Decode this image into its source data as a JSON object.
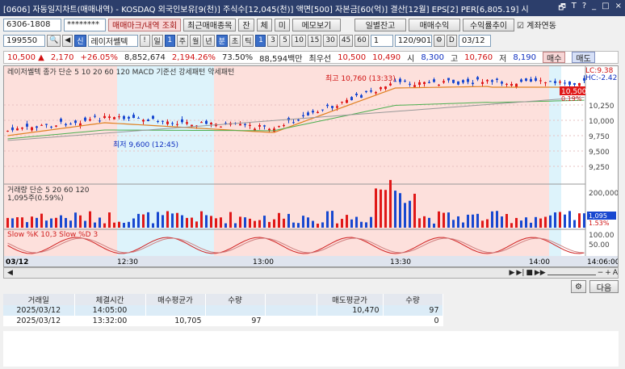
{
  "titlebar": {
    "text": "[0606] 자동일지차트(매매내역) - KOSDAQ 외국인보유[9(천)] 주식수[12,045(천)] 액면[500] 자본금[60(억)] 결산[12월] EPS[2] PER[6,805.19] 시",
    "controls": [
      "🗗",
      "T",
      "?",
      "_",
      "□",
      "×"
    ]
  },
  "toolbar1": {
    "account": "6306-1808",
    "password": "********",
    "buttons": [
      "매매마크/내역 조회",
      "최근매매종목",
      "잔",
      "체",
      "미",
      "메모보기",
      "일별잔고",
      "매매수익",
      "수익률추이"
    ],
    "checkbox": "계좌연동"
  },
  "toolbar2": {
    "code": "199550",
    "stock_label": "레이저쎌텍",
    "period": "일",
    "period_value": "1",
    "units": [
      "주",
      "월",
      "년",
      "분",
      "초",
      "틱"
    ],
    "active_unit": "분",
    "intervals": [
      "1",
      "3",
      "5",
      "10",
      "15",
      "30",
      "45",
      "60"
    ],
    "count": "1",
    "page": "120/901",
    "date": "03/12",
    "date_check": "D"
  },
  "quote": {
    "price": "10,500 ▲",
    "change": "2,170",
    "pct": "+26.05%",
    "volume": "8,852,674",
    "vol_pct": "2,194.26%",
    "ratio": "73.50%",
    "amount": "88,594백만",
    "best_sell_label": "최우선",
    "best_sell": "10,500",
    "best_buy": "10,490",
    "open_label": "시",
    "open": "8,300",
    "high_label": "고",
    "high": "10,760",
    "low_label": "저",
    "low": "8,190",
    "buy_btn": "매수",
    "sell_btn": "매도"
  },
  "chart": {
    "legend_main": "레이저쎌텍  종가 단순 5 10 20 60 120  MACD 기준선 강세패턴 약세패턴",
    "lc": "LC:9.38",
    "hc": "HC:-2.42",
    "last": "10,500",
    "last_pct": "0.19%",
    "high_note": "최고 10,760 (13:33)",
    "low_note": "최저 9,600 (12:45)",
    "y_ticks": [
      "10,250",
      "10,000",
      "9,750",
      "9,500",
      "9,250"
    ],
    "vol_legend": "거래량 단순 5 20 60 120",
    "vol_note": "1,095주(0.59%)",
    "vol_ticks": [
      "200,000"
    ],
    "vol_last": "1,095",
    "vol_last_pct": "1.53%",
    "stoch_legend": "Slow %K 10,3  Slow %D 3",
    "stoch_ticks": [
      "100.00",
      "50.00"
    ],
    "x_labels": [
      "03/12",
      "12:30",
      "13:00",
      "13:30",
      "14:00",
      "14:06:00"
    ]
  },
  "colors": {
    "up": "#e01818",
    "down": "#1848d0",
    "pink": "#fde0dc",
    "cyan": "#ddf3fb"
  },
  "table": {
    "headers": [
      "거래일",
      "체결시간",
      "매수평균가",
      "수량",
      "",
      "매도평균가",
      "수량"
    ],
    "rows": [
      [
        "2025/03/12",
        "14:05:00",
        "",
        "",
        "",
        "10,470",
        "97"
      ],
      [
        "2025/03/12",
        "13:32:00",
        "10,705",
        "97",
        "",
        "",
        "0"
      ]
    ]
  },
  "next_btn": "다음"
}
